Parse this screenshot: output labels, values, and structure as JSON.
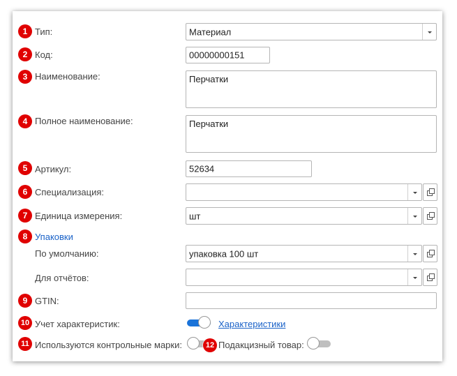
{
  "form": {
    "type": {
      "num": "1",
      "label": "Тип:",
      "value": "Материал"
    },
    "code": {
      "num": "2",
      "label": "Код:",
      "value": "00000000151"
    },
    "name": {
      "num": "3",
      "label": "Наименование:",
      "value": "Перчатки"
    },
    "full_name": {
      "num": "4",
      "label": "Полное наименование:",
      "value": "Перчатки"
    },
    "article": {
      "num": "5",
      "label": "Артикул:",
      "value": "52634"
    },
    "specialization": {
      "num": "6",
      "label": "Специализация:",
      "value": ""
    },
    "unit": {
      "num": "7",
      "label": "Единица измерения:",
      "value": "шт"
    },
    "packages": {
      "num": "8",
      "link": "Упаковки"
    },
    "default_pkg": {
      "label": "По умолчанию:",
      "value": "упаковка 100 шт"
    },
    "report_pkg": {
      "label": "Для отчётов:",
      "value": ""
    },
    "gtin": {
      "num": "9",
      "label": "GTIN:",
      "value": ""
    },
    "characteristics": {
      "num": "10",
      "label": "Учет характеристик:",
      "toggle_on": true,
      "link": "Характеристики"
    },
    "control_marks": {
      "num": "11",
      "label": "Используются контрольные марки:",
      "toggle_on": false
    },
    "excise": {
      "num": "12",
      "label": "Подакцизный товар:",
      "toggle_on": false
    }
  },
  "colors": {
    "badge": "#e00000",
    "toggle_on": "#1a73d9",
    "toggle_off": "#bfbfbf",
    "link": "#1a62c8"
  }
}
